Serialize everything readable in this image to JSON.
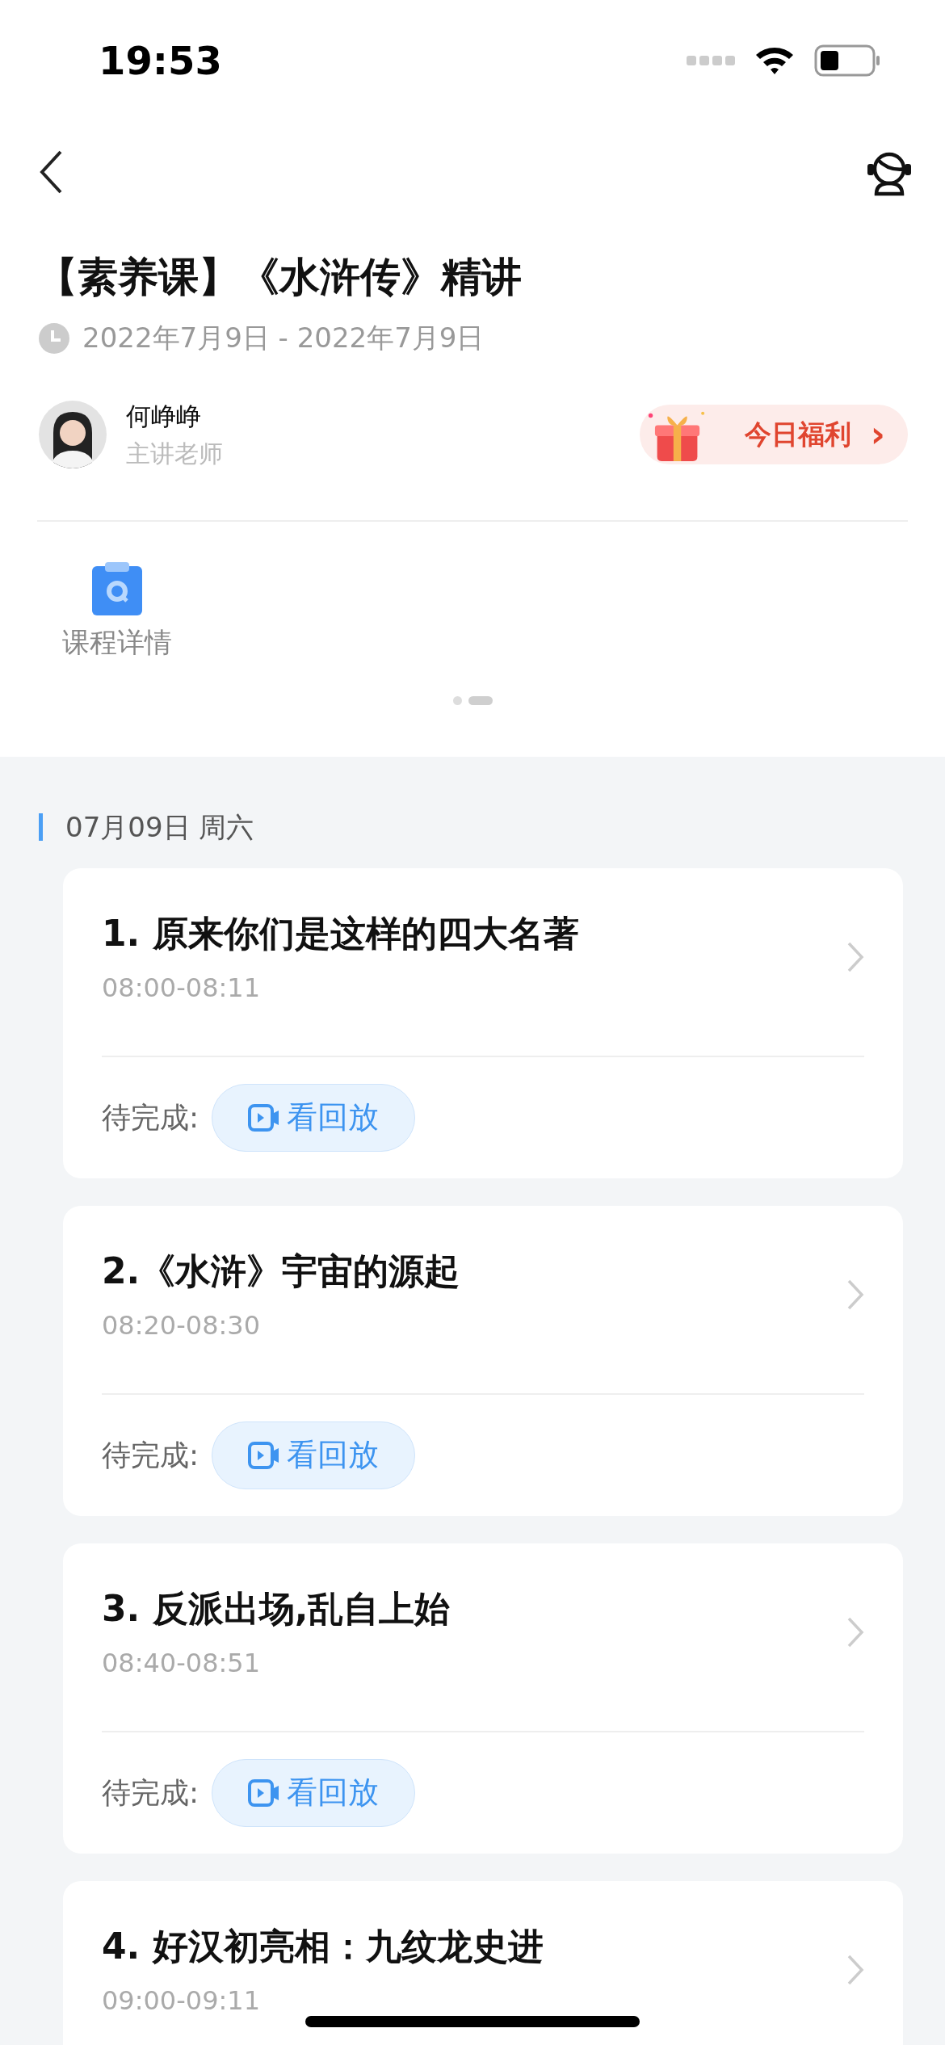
{
  "status_bar": {
    "time": "19:53"
  },
  "course": {
    "title": "【素养课】《水浒传》精讲",
    "dates": "2022年7月9日 - 2022年7月9日"
  },
  "teacher": {
    "name": "何峥峥",
    "role": "主讲老师"
  },
  "welfare": {
    "label": "今日福利",
    "arrow": "›"
  },
  "tools": [
    {
      "label": "课程详情"
    }
  ],
  "pager": [
    {
      "selected": false
    },
    {
      "selected": true
    }
  ],
  "day": {
    "label": "07月09日 周六"
  },
  "lessons": [
    {
      "title": "1. 原来你们是这样的四大名著",
      "time": "08:00-08:11",
      "pending_label": "待完成:",
      "action": "看回放"
    },
    {
      "title": "2.《水浒》宇宙的源起",
      "time": "08:20-08:30",
      "pending_label": "待完成:",
      "action": "看回放"
    },
    {
      "title": "3. 反派出场,乱自上始",
      "time": "08:40-08:51",
      "pending_label": "待完成:",
      "action": "看回放"
    },
    {
      "title": "4. 好汉初亮相：九纹龙史进",
      "time": "09:00-09:11"
    }
  ]
}
